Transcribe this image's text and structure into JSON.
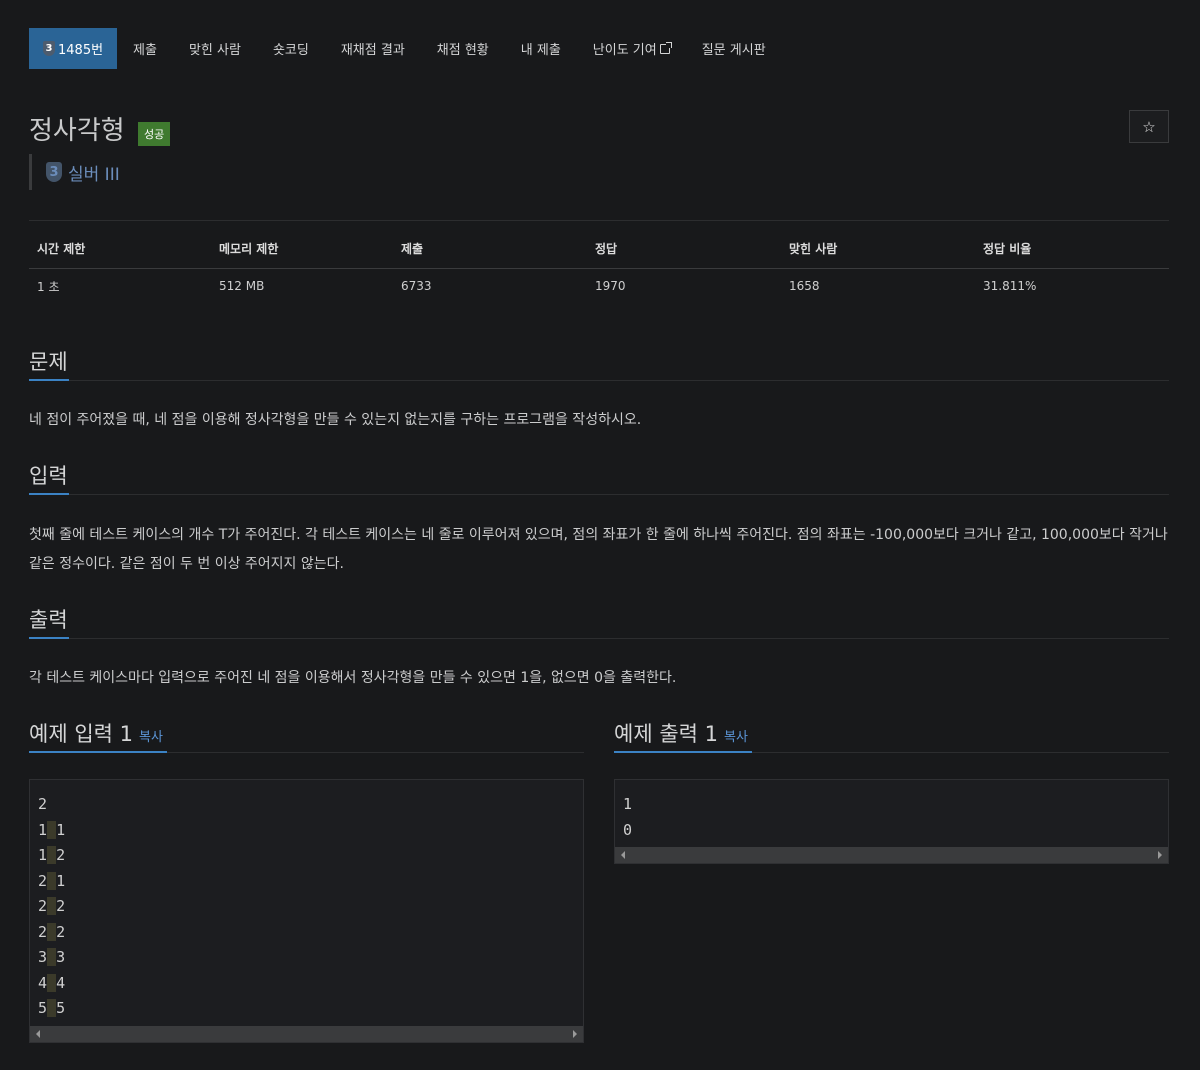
{
  "nav": {
    "tabs": [
      {
        "label": "1485번",
        "tier": "3",
        "active": true
      },
      {
        "label": "제출"
      },
      {
        "label": "맞힌 사람"
      },
      {
        "label": "숏코딩"
      },
      {
        "label": "재채점 결과"
      },
      {
        "label": "채점 현황"
      },
      {
        "label": "내 제출"
      },
      {
        "label": "난이도 기여"
      },
      {
        "label": "질문 게시판"
      }
    ]
  },
  "problem": {
    "title": "정사각형",
    "badge": "성공",
    "star": "☆",
    "tier_number": "3",
    "tier_label": "실버 III"
  },
  "info": {
    "headers": [
      "시간 제한",
      "메모리 제한",
      "제출",
      "정답",
      "맞힌 사람",
      "정답 비율"
    ],
    "values": [
      "1 초",
      "512 MB",
      "6733",
      "1970",
      "1658",
      "31.811%"
    ]
  },
  "sections": {
    "problem_heading": "문제",
    "problem_text": "네 점이 주어졌을 때, 네 점을 이용해 정사각형을 만들 수 있는지 없는지를 구하는 프로그램을 작성하시오.",
    "input_heading": "입력",
    "input_text": "첫째 줄에 테스트 케이스의 개수 T가 주어진다. 각 테스트 케이스는 네 줄로 이루어져 있으며, 점의 좌표가 한 줄에 하나씩 주어진다. 점의 좌표는 -100,000보다 크거나 같고, 100,000보다 작거나 같은 정수이다. 같은 점이 두 번 이상 주어지지 않는다.",
    "output_heading": "출력",
    "output_text": "각 테스트 케이스마다 입력으로 주어진 네 점을 이용해서 정사각형을 만들 수 있으면 1을, 없으면 0을 출력한다."
  },
  "samples": {
    "input_heading": "예제 입력 1",
    "output_heading": "예제 출력 1",
    "copy_label": "복사",
    "input_lines": [
      [
        "2"
      ],
      [
        "1",
        "1"
      ],
      [
        "1",
        "2"
      ],
      [
        "2",
        "1"
      ],
      [
        "2",
        "2"
      ],
      [
        "2",
        "2"
      ],
      [
        "3",
        "3"
      ],
      [
        "4",
        "4"
      ],
      [
        "5",
        "5"
      ]
    ],
    "output_lines": [
      "1",
      "0"
    ]
  }
}
